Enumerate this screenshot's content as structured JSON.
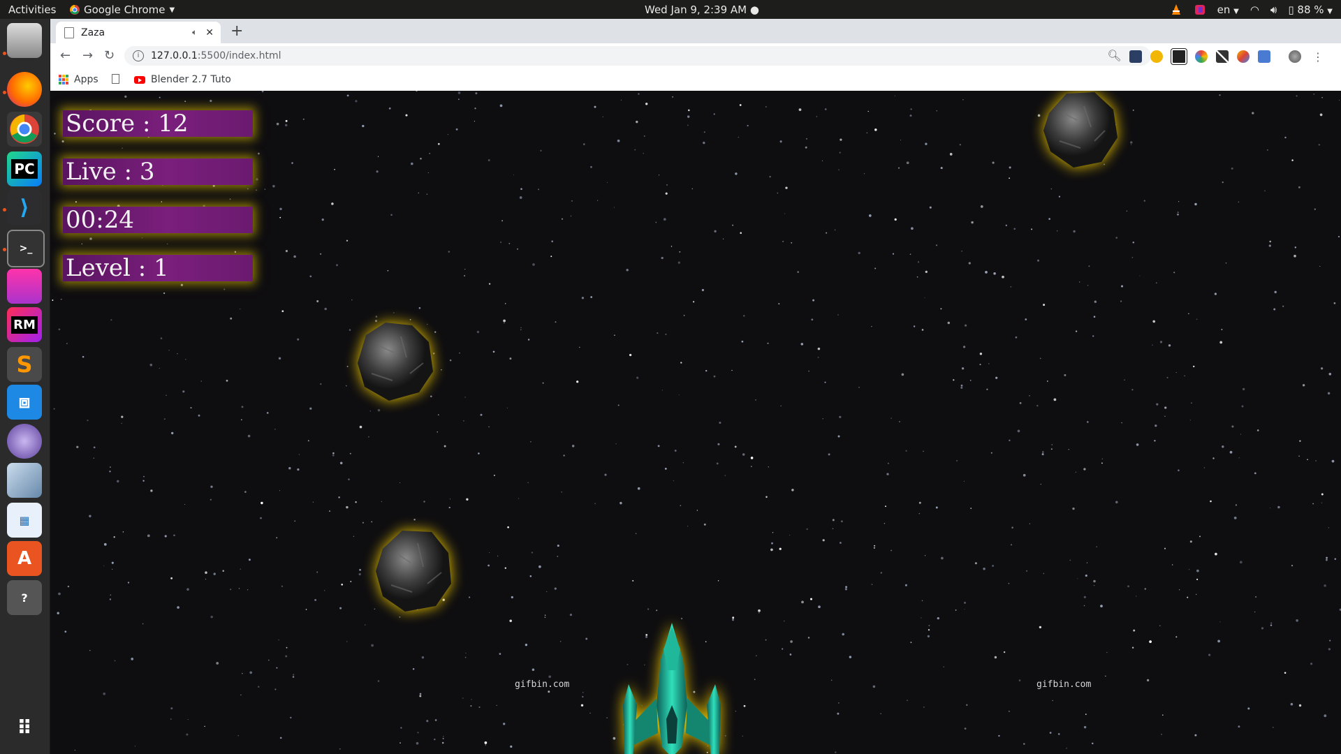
{
  "system": {
    "activities": "Activities",
    "app_menu": "Google Chrome",
    "clock": "Wed Jan  9,  2:39 AM",
    "language": "en",
    "battery": "88 %"
  },
  "browser": {
    "tab_title": "Zaza",
    "url_host": "127.0.0.1",
    "url_path": ":5500/index.html",
    "bookmarks": [
      {
        "label": "Apps"
      },
      {
        "label": "Blender 2.7 Tuto"
      }
    ]
  },
  "game": {
    "score": "Score : 12",
    "lives": "Live : 3",
    "timer": "00:24",
    "level": "Level : 1",
    "watermark_left": "gifbin.com",
    "watermark_right": "gifbin.com"
  },
  "colors": {
    "hud_purple": "#7a1f7c",
    "glow_yellow": "#ffd700",
    "space": "#0e0d10",
    "ship_teal": "#1fb89a"
  },
  "icons": [
    "chrome-icon",
    "files-icon",
    "firefox-icon",
    "pycharm-icon",
    "vscode-icon",
    "terminal-icon",
    "rubymine-icon",
    "sublime-icon",
    "software-icon",
    "asteroid-icon",
    "spaceship-icon"
  ]
}
